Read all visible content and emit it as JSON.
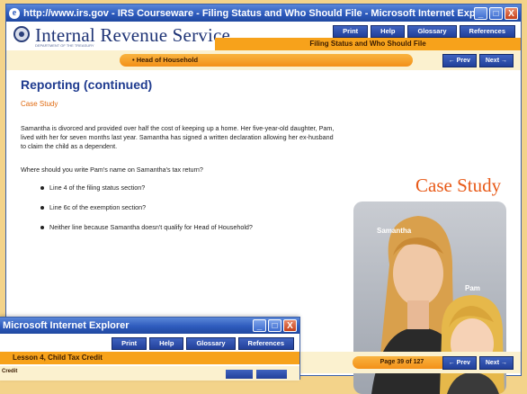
{
  "browser": {
    "title": "http://www.irs.gov - IRS Courseware - Filing Status and Who Should File - Microsoft Internet Explorer",
    "window_buttons": [
      "_",
      "□",
      "X"
    ]
  },
  "header": {
    "brand": "Internal Revenue Service",
    "brand_sub": "DEPARTMENT OF THE TREASURY",
    "nav": [
      "Print",
      "Help",
      "Glossary",
      "References"
    ],
    "section": "Filing Status and Who Should File"
  },
  "lesson": {
    "label": "Head of Household",
    "prev": "Prev",
    "next": "Next"
  },
  "content": {
    "title": "Reporting (continued)",
    "subtitle": "Case Study",
    "paragraph": "Samantha is divorced and provided over half the cost of keeping up a home. Her five-year-old daughter, Pam, lived with her for seven months last year. Samantha has signed a written declaration allowing her ex-husband to claim the child as a dependent.",
    "question": "Where should you write Pam's name on Samantha's tax return?",
    "options": [
      "Line 4 of the filing status section?",
      "Line 6c of the exemption section?",
      "Neither line because Samantha doesn't qualify for Head of Household?"
    ],
    "case_study_heading": "Case Study",
    "photo_labels": [
      "Samantha",
      "Pam"
    ]
  },
  "footer": {
    "page": "Page 39 of 127",
    "prev": "Prev",
    "next": "Next"
  },
  "back_window": {
    "title": "Microsoft Internet Explorer",
    "nav": [
      "Print",
      "Help",
      "Glossary",
      "References"
    ],
    "lesson": "Lesson 4, Child Tax Credit",
    "cut_text": "Credit"
  },
  "colors": {
    "accent_orange": "#f7a21b",
    "nav_blue": "#22409a",
    "title_blue": "#1f3b8f",
    "case_orange": "#e85a18"
  }
}
